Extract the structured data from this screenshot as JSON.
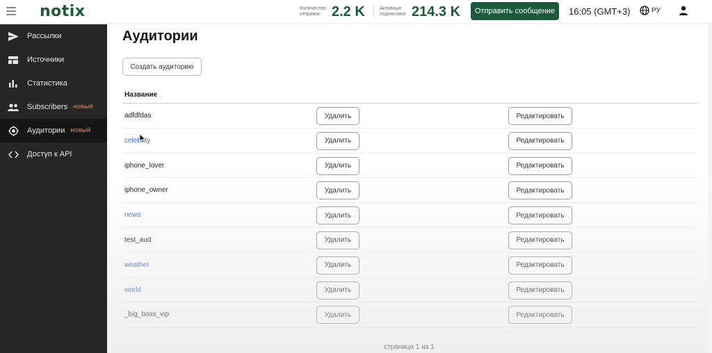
{
  "header": {
    "logo": "notix",
    "stat_sent_caption": "Количество отправок",
    "stat_sent_value": "2.2 K",
    "stat_active_caption": "Активные подписчики",
    "stat_active_value": "214.3 K",
    "send_button": "Отправить сообщение",
    "time": "16:05 (GMT+3)",
    "language": "РУ"
  },
  "sidebar": {
    "items": [
      {
        "label": "Рассылки",
        "icon": "send-icon",
        "badge": ""
      },
      {
        "label": "Источники",
        "icon": "sources-icon",
        "badge": ""
      },
      {
        "label": "Статистика",
        "icon": "stats-icon",
        "badge": ""
      },
      {
        "label": "Subscribers",
        "icon": "people-icon",
        "badge": "НОВЫЙ"
      },
      {
        "label": "Аудитории",
        "icon": "target-icon",
        "badge": "НОВЫЙ"
      },
      {
        "label": "Доступ к API",
        "icon": "code-icon",
        "badge": ""
      }
    ],
    "active_index": 4
  },
  "main": {
    "title": "Аудитории",
    "create_button": "Создать аудиторию",
    "table": {
      "column_name": "Название",
      "delete_label": "Удалить",
      "edit_label": "Редактировать",
      "rows": [
        {
          "name": "adfdfdas",
          "link": false
        },
        {
          "name": "celebrity",
          "link": true
        },
        {
          "name": "iphone_lover",
          "link": false
        },
        {
          "name": "iphone_owner",
          "link": false
        },
        {
          "name": "news",
          "link": true
        },
        {
          "name": "test_aud",
          "link": false
        },
        {
          "name": "weather",
          "link": true
        },
        {
          "name": "world",
          "link": true
        },
        {
          "name": "_big_boss_vip",
          "link": false
        }
      ]
    },
    "pagination": "страница 1 из 1"
  },
  "colors": {
    "brand": "#1d5a3c",
    "sidebar_bg": "#262626",
    "badge": "#e07040",
    "link": "#3a6bd6"
  }
}
